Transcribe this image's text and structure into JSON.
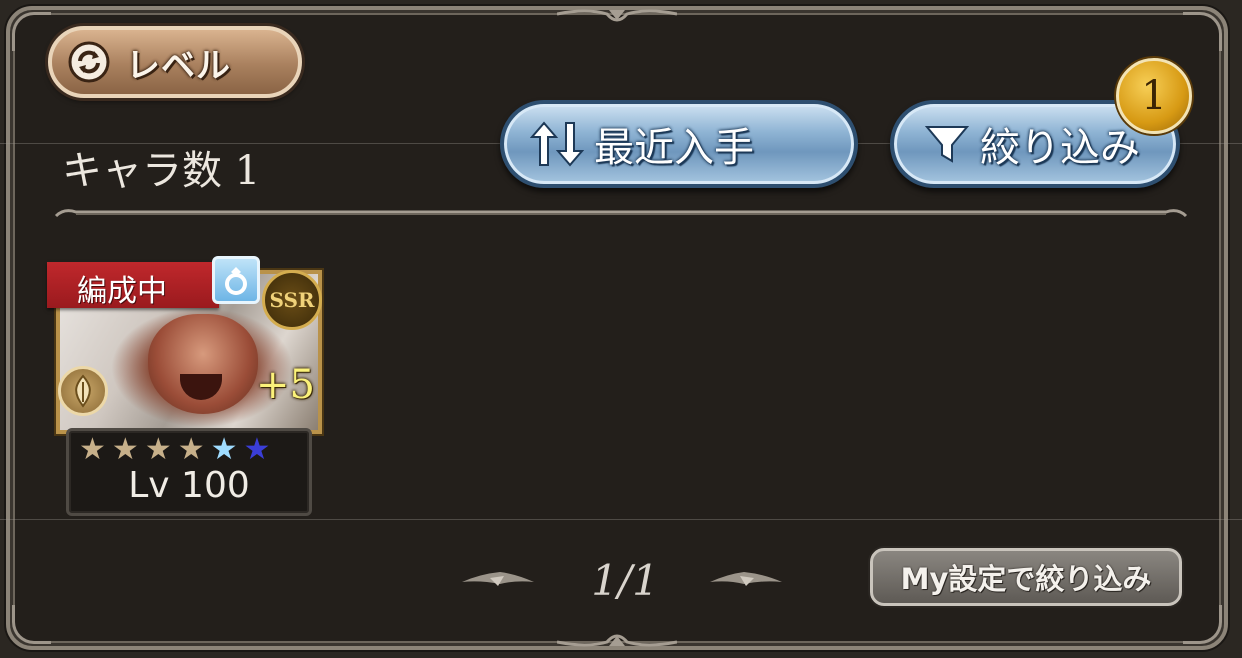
{
  "sort_mode": {
    "label": "レベル",
    "icon": "cycle-icon"
  },
  "character_count": "キャラ数 1",
  "sort_button": {
    "label": "最近入手",
    "icon": "sort-arrows-icon"
  },
  "filter_button": {
    "label": "絞り込み",
    "icon": "funnel-icon",
    "badge_count": "1"
  },
  "characters": [
    {
      "status_label": "編成中",
      "rarity": "SSR",
      "plus_bonus": "+5",
      "level": "Lv 100",
      "stars_filled": 4,
      "stars_total": 6,
      "colors": {
        "band": "#c0282c",
        "plus": "#fbf27a"
      }
    }
  ],
  "pagination": {
    "current": "1/1"
  },
  "my_filter_button": {
    "label": "My設定で絞り込み"
  },
  "colors": {
    "background": "#231f1b",
    "accent_gold": "#d79a14",
    "button_blue": "#8fb4d4"
  }
}
